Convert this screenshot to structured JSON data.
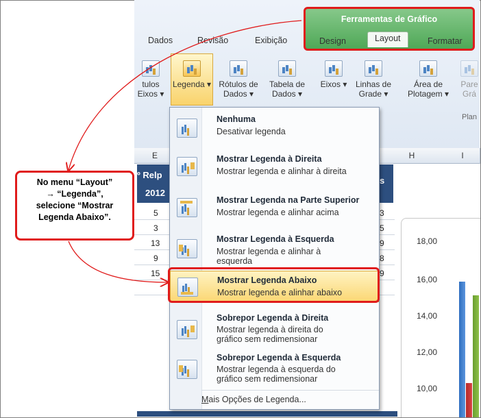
{
  "ribbon": {
    "tabs": [
      "Dados",
      "Revisão",
      "Exibição"
    ],
    "tools_title": "Ferramentas de Gráfico",
    "tools_tabs": [
      "Design",
      "Layout",
      "Formatar"
    ],
    "commands": [
      {
        "label": "tulos Eixos ▾"
      },
      {
        "label": "Legenda ▾"
      },
      {
        "label": "Rótulos de Dados ▾"
      },
      {
        "label": "Tabela de Dados ▾"
      },
      {
        "label": "Eixos ▾"
      },
      {
        "label": "Linhas de Grade ▾"
      },
      {
        "label": "Área de Plotagem ▾"
      },
      {
        "label": "Pare Grá"
      },
      {
        "label": "Plan"
      }
    ]
  },
  "sheet": {
    "columns": [
      "E",
      "H",
      "I"
    ],
    "header_cells": [
      "º Relp",
      "2012",
      "s"
    ],
    "rows": [
      {
        "e": "5",
        "right": "3"
      },
      {
        "e": "3",
        "right": "5"
      },
      {
        "e": "13",
        "right": "9"
      },
      {
        "e": "9",
        "right": "8"
      },
      {
        "e": "15",
        "right": "9"
      }
    ]
  },
  "chart_data": {
    "type": "bar",
    "y_ticks": [
      "18,00",
      "16,00",
      "14,00",
      "12,00",
      "10,00"
    ]
  },
  "menu": {
    "items": [
      {
        "title": "Nenhuma",
        "desc": "Desativar legenda",
        "icon": "no-legend-icon"
      },
      {
        "title": "Mostrar Legenda à Direita",
        "desc": "Mostrar legenda e alinhar à direita",
        "icon": "legend-right-icon"
      },
      {
        "title": "Mostrar Legenda na Parte Superior",
        "desc": "Mostrar legenda e alinhar acima",
        "icon": "legend-top-icon"
      },
      {
        "title": "Mostrar Legenda à Esquerda",
        "desc": "Mostrar legenda e alinhar à esquerda",
        "icon": "legend-left-icon"
      },
      {
        "title": "Mostrar Legenda Abaixo",
        "desc": "Mostrar legenda e alinhar abaixo",
        "icon": "legend-bottom-icon"
      },
      {
        "title": "Sobrepor Legenda à Direita",
        "desc": "Mostrar legenda à direita do gráfico sem redimensionar",
        "icon": "overlay-right-icon"
      },
      {
        "title": "Sobrepor Legenda à Esquerda",
        "desc": "Mostrar legenda à esquerda do gráfico sem redimensionar",
        "icon": "overlay-left-icon"
      }
    ],
    "more_prefix": "M",
    "more_rest": "ais Opções de Legenda..."
  },
  "callout": {
    "line1": "No menu “Layout”",
    "line2": "→ “Legenda”,",
    "line3": "selecione “Mostrar",
    "line4": "Legenda Abaixo”."
  },
  "colors": {
    "highlight": "#e01b1b",
    "tools_green": "#4fa857",
    "navy": "#2d4f7f"
  }
}
